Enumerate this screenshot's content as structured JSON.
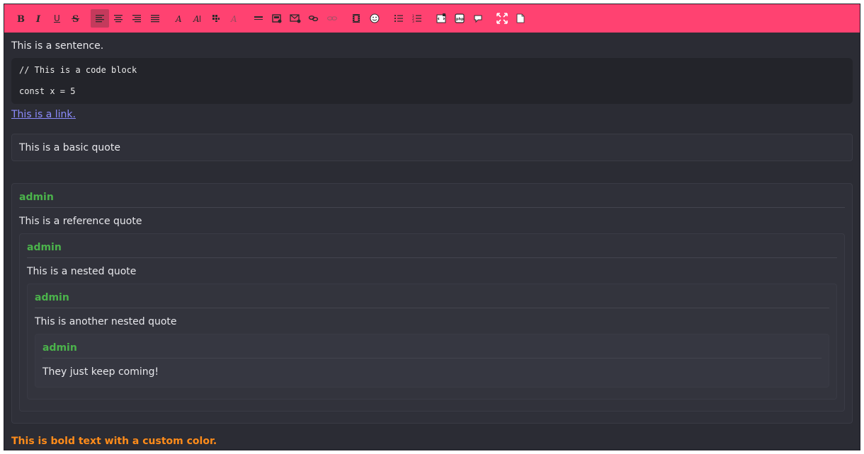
{
  "toolbar": {
    "buttons": [
      {
        "name": "bold-button",
        "glyph": "B",
        "style": "bold-serif"
      },
      {
        "name": "italic-button",
        "glyph": "I",
        "style": "italic-serif"
      },
      {
        "name": "underline-button",
        "glyph": "U",
        "style": "underline"
      },
      {
        "name": "strikethrough-button",
        "glyph": "S",
        "style": "strike"
      },
      {
        "name": "align-left-button",
        "glyph": "≡",
        "active": true
      },
      {
        "name": "align-center-button",
        "glyph": "≡"
      },
      {
        "name": "align-right-button",
        "glyph": "≡"
      },
      {
        "name": "justify-button",
        "glyph": "≡"
      },
      {
        "name": "font-button",
        "glyph": "A"
      },
      {
        "name": "size-button",
        "glyph": "A"
      },
      {
        "name": "color-button",
        "glyph": "▦"
      },
      {
        "name": "remove-format-button",
        "glyph": "A",
        "muted": true
      },
      {
        "name": "horizontal-rule-button",
        "glyph": "▬"
      },
      {
        "name": "insert-image-button",
        "glyph": "▣"
      },
      {
        "name": "insert-email-button",
        "glyph": "✉"
      },
      {
        "name": "insert-link-button",
        "glyph": "⛓"
      },
      {
        "name": "unlink-button",
        "glyph": "⛓",
        "muted": true
      },
      {
        "name": "insert-video-button",
        "glyph": "▥"
      },
      {
        "name": "emoticon-button",
        "glyph": "☺"
      },
      {
        "name": "bullet-list-button",
        "glyph": "☰"
      },
      {
        "name": "ordered-list-button",
        "glyph": "☰"
      },
      {
        "name": "code-button",
        "glyph": "⎘"
      },
      {
        "name": "php-button",
        "glyph": "php"
      },
      {
        "name": "quote-button",
        "glyph": "❝"
      },
      {
        "name": "maximize-button",
        "glyph": "⤢"
      },
      {
        "name": "source-button",
        "glyph": "▯"
      }
    ]
  },
  "content": {
    "sentence": "This is a sentence.",
    "code_lines": [
      "// This is a code block",
      "const x = 5"
    ],
    "link_text": "This is a link.",
    "basic_quote": "This is a basic quote",
    "ref_quote": {
      "author": "admin",
      "text": "This is a reference quote",
      "nested": {
        "author": "admin",
        "text": "This is a nested quote",
        "nested": {
          "author": "admin",
          "text": "This is another nested quote",
          "nested": {
            "author": "admin",
            "text": "They just keep coming!"
          }
        }
      }
    },
    "bold_text": "This is bold text with a custom color."
  },
  "colors": {
    "toolbar_bg": "#ff4271",
    "editor_bg": "#2b2c34",
    "author": "#4bb34b",
    "link": "#8c8cff",
    "custom_bold": "#ff8c1a"
  }
}
